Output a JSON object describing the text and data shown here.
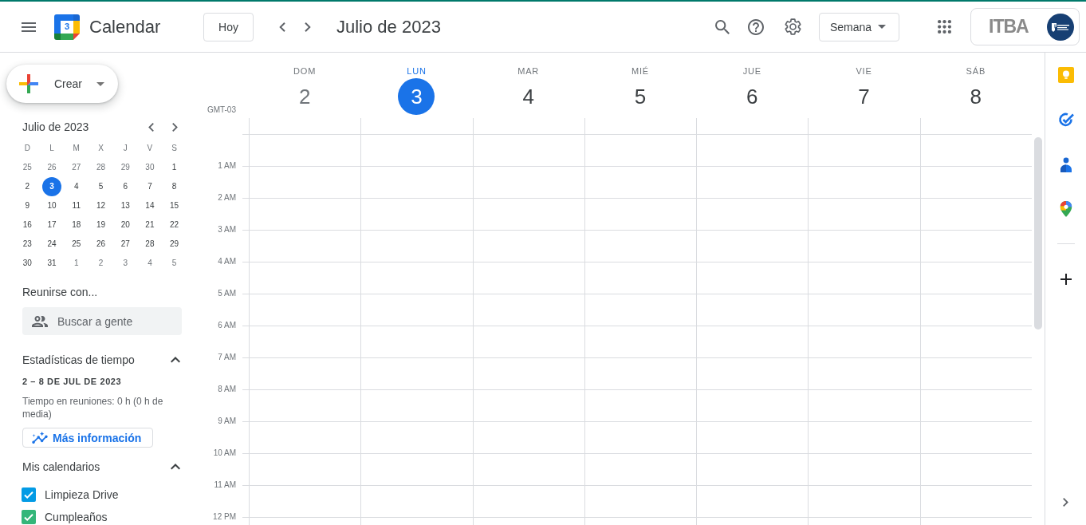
{
  "top_bar": {
    "logo_day": "3",
    "app_title": "Calendar",
    "today_button": "Hoy",
    "period": "Julio de 2023",
    "view_select": "Semana",
    "account_logo": "ITBA"
  },
  "sidebar": {
    "create_button": "Crear",
    "mini_calendar": {
      "title": "Julio de 2023",
      "weekdays": [
        "D",
        "L",
        "M",
        "X",
        "J",
        "V",
        "S"
      ],
      "weeks": [
        [
          {
            "day": "25",
            "in_month": false,
            "selected": false
          },
          {
            "day": "26",
            "in_month": false,
            "selected": false
          },
          {
            "day": "27",
            "in_month": false,
            "selected": false
          },
          {
            "day": "28",
            "in_month": false,
            "selected": false
          },
          {
            "day": "29",
            "in_month": false,
            "selected": false
          },
          {
            "day": "30",
            "in_month": false,
            "selected": false
          },
          {
            "day": "1",
            "in_month": true,
            "selected": false
          }
        ],
        [
          {
            "day": "2",
            "in_month": true,
            "selected": false
          },
          {
            "day": "3",
            "in_month": true,
            "selected": true
          },
          {
            "day": "4",
            "in_month": true,
            "selected": false
          },
          {
            "day": "5",
            "in_month": true,
            "selected": false
          },
          {
            "day": "6",
            "in_month": true,
            "selected": false
          },
          {
            "day": "7",
            "in_month": true,
            "selected": false
          },
          {
            "day": "8",
            "in_month": true,
            "selected": false
          }
        ],
        [
          {
            "day": "9",
            "in_month": true,
            "selected": false
          },
          {
            "day": "10",
            "in_month": true,
            "selected": false
          },
          {
            "day": "11",
            "in_month": true,
            "selected": false
          },
          {
            "day": "12",
            "in_month": true,
            "selected": false
          },
          {
            "day": "13",
            "in_month": true,
            "selected": false
          },
          {
            "day": "14",
            "in_month": true,
            "selected": false
          },
          {
            "day": "15",
            "in_month": true,
            "selected": false
          }
        ],
        [
          {
            "day": "16",
            "in_month": true,
            "selected": false
          },
          {
            "day": "17",
            "in_month": true,
            "selected": false
          },
          {
            "day": "18",
            "in_month": true,
            "selected": false
          },
          {
            "day": "19",
            "in_month": true,
            "selected": false
          },
          {
            "day": "20",
            "in_month": true,
            "selected": false
          },
          {
            "day": "21",
            "in_month": true,
            "selected": false
          },
          {
            "day": "22",
            "in_month": true,
            "selected": false
          }
        ],
        [
          {
            "day": "23",
            "in_month": true,
            "selected": false
          },
          {
            "day": "24",
            "in_month": true,
            "selected": false
          },
          {
            "day": "25",
            "in_month": true,
            "selected": false
          },
          {
            "day": "26",
            "in_month": true,
            "selected": false
          },
          {
            "day": "27",
            "in_month": true,
            "selected": false
          },
          {
            "day": "28",
            "in_month": true,
            "selected": false
          },
          {
            "day": "29",
            "in_month": true,
            "selected": false
          }
        ],
        [
          {
            "day": "30",
            "in_month": true,
            "selected": false
          },
          {
            "day": "31",
            "in_month": true,
            "selected": false
          },
          {
            "day": "1",
            "in_month": false,
            "selected": false
          },
          {
            "day": "2",
            "in_month": false,
            "selected": false
          },
          {
            "day": "3",
            "in_month": false,
            "selected": false
          },
          {
            "day": "4",
            "in_month": false,
            "selected": false
          },
          {
            "day": "5",
            "in_month": false,
            "selected": false
          }
        ]
      ]
    },
    "meet": {
      "title": "Reunirse con...",
      "placeholder": "Buscar a gente"
    },
    "time_insights": {
      "title": "Estadísticas de tiempo",
      "expanded": true,
      "range": "2 – 8 DE JUL DE 2023",
      "summary": "Tiempo en reuniones: 0 h (0 h de media)",
      "link": "Más información"
    },
    "my_calendars": {
      "title": "Mis calendarios",
      "expanded": true,
      "items": [
        {
          "label": "Limpieza Drive",
          "checked": true,
          "color": "#039be5"
        },
        {
          "label": "Cumpleaños",
          "checked": true,
          "color": "#33b679"
        }
      ]
    }
  },
  "week_view": {
    "timezone": "GMT-03",
    "days": [
      {
        "name": "DOM",
        "number": "2",
        "selected": false,
        "past": true
      },
      {
        "name": "LUN",
        "number": "3",
        "selected": true,
        "past": false
      },
      {
        "name": "MAR",
        "number": "4",
        "selected": false,
        "past": false
      },
      {
        "name": "MIÉ",
        "number": "5",
        "selected": false,
        "past": false
      },
      {
        "name": "JUE",
        "number": "6",
        "selected": false,
        "past": false
      },
      {
        "name": "VIE",
        "number": "7",
        "selected": false,
        "past": false
      },
      {
        "name": "SÁB",
        "number": "8",
        "selected": false,
        "past": false
      }
    ],
    "hours": [
      "1 AM",
      "2 AM",
      "3 AM",
      "4 AM",
      "5 AM",
      "6 AM",
      "7 AM",
      "8 AM",
      "9 AM",
      "10 AM",
      "11 AM",
      "12 PM"
    ]
  }
}
